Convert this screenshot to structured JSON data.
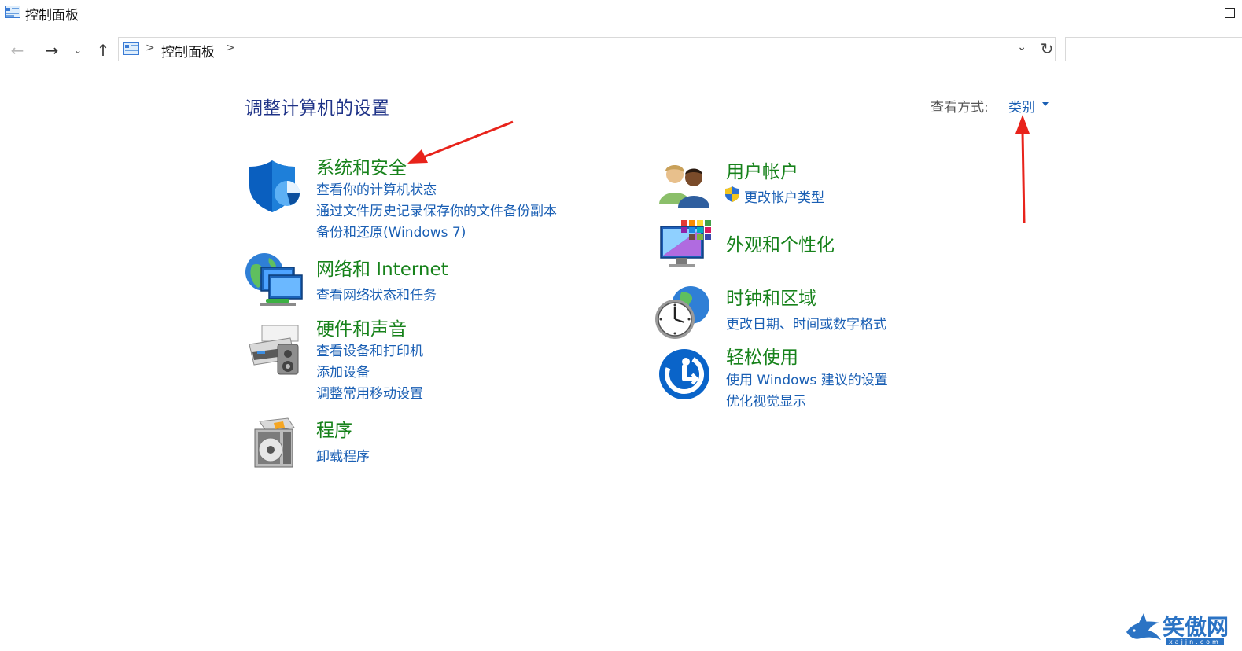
{
  "window": {
    "title": "控制面板"
  },
  "address_bar": {
    "crumb": "控制面板",
    "separator": ">"
  },
  "main": {
    "title": "调整计算机的设置",
    "view_by_label": "查看方式:",
    "view_by_value": "类别"
  },
  "categories": [
    {
      "title": "系统和安全",
      "icon": "shield-icon",
      "links": [
        "查看你的计算机状态",
        "通过文件历史记录保存你的文件备份副本",
        "备份和还原(Windows 7)"
      ]
    },
    {
      "title": "网络和 Internet",
      "icon": "network-globe-icon",
      "links": [
        "查看网络状态和任务"
      ]
    },
    {
      "title": "硬件和声音",
      "icon": "printer-speaker-icon",
      "links": [
        "查看设备和打印机",
        "添加设备",
        "调整常用移动设置"
      ]
    },
    {
      "title": "程序",
      "icon": "programs-disc-icon",
      "links": [
        "卸载程序"
      ]
    },
    {
      "title": "用户帐户",
      "icon": "users-icon",
      "links": [
        "更改帐户类型"
      ]
    },
    {
      "title": "外观和个性化",
      "icon": "monitor-palette-icon",
      "links": []
    },
    {
      "title": "时钟和区域",
      "icon": "clock-globe-icon",
      "links": [
        "更改日期、时间或数字格式"
      ]
    },
    {
      "title": "轻松使用",
      "icon": "ease-of-access-icon",
      "links": [
        "使用 Windows 建议的设置",
        "优化视觉显示"
      ]
    }
  ],
  "watermark": {
    "text": "笑傲网",
    "sub": "xajjn.com"
  },
  "colors": {
    "category_title": "#17821b",
    "link": "#1a5fb4",
    "page_title": "#1e3287",
    "annotation_arrow": "#e8231b"
  }
}
